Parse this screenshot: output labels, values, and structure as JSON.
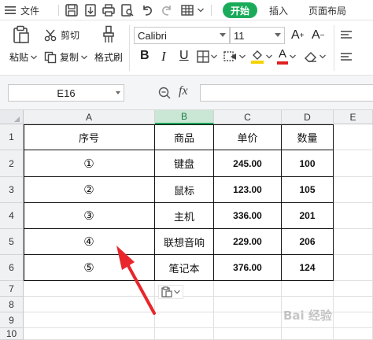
{
  "menubar": {
    "file_label": "文件",
    "start_tab": "开始",
    "insert_tab": "插入",
    "layout_tab": "页面布局"
  },
  "ribbon": {
    "paste_label": "粘贴",
    "cut_label": "剪切",
    "copy_label": "复制",
    "format_painter_label": "格式刷",
    "font_name": "Calibri",
    "font_size": "11",
    "bold_glyph": "B",
    "italic_glyph": "I",
    "underline_glyph": "U",
    "font_color_glyph": "A",
    "font_color": "#e02020",
    "highlight_color": "#f5d300"
  },
  "formula_bar": {
    "name_box": "E16",
    "fx_label": "fx",
    "formula": ""
  },
  "grid": {
    "columns": [
      "A",
      "B",
      "C",
      "D",
      "E"
    ],
    "selected_column": "B",
    "rows": [
      "1",
      "2",
      "3",
      "4",
      "5",
      "6",
      "7",
      "8",
      "9",
      "10"
    ]
  },
  "table": {
    "headers": [
      "序号",
      "商品",
      "单价",
      "数量"
    ],
    "rows": [
      {
        "seq": "①",
        "item": "键盘",
        "price": "245.00",
        "qty": "100"
      },
      {
        "seq": "②",
        "item": "鼠标",
        "price": "123.00",
        "qty": "105"
      },
      {
        "seq": "③",
        "item": "主机",
        "price": "336.00",
        "qty": "201"
      },
      {
        "seq": "④",
        "item": "联想音响",
        "price": "229.00",
        "qty": "206"
      },
      {
        "seq": "⑤",
        "item": "笔记本",
        "price": "376.00",
        "qty": "124"
      }
    ]
  },
  "annotation": {
    "arrow_color": "#e8262b"
  },
  "watermark": "Bai 经验"
}
